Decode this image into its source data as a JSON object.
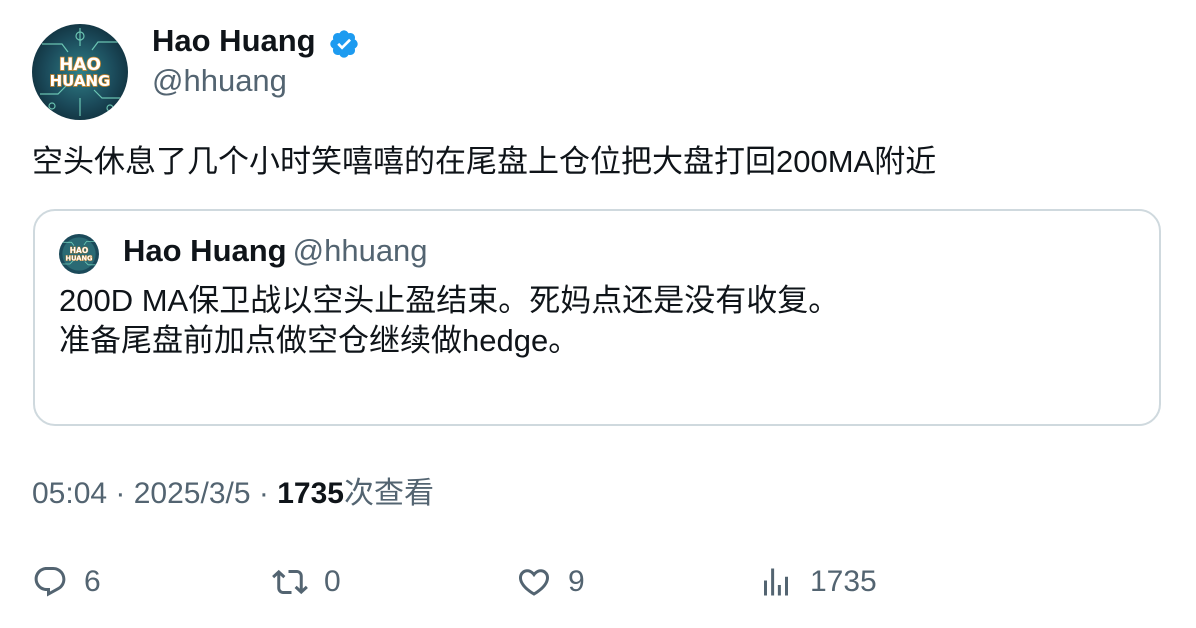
{
  "author": {
    "name": "Hao Huang",
    "handle": "@hhuang",
    "verified": true,
    "avatar_text_line1": "HAO",
    "avatar_text_line2": "HUANG"
  },
  "tweet": {
    "text": "空头休息了几个小时笑嘻嘻的在尾盘上仓位把大盘打回200MA附近"
  },
  "quote": {
    "name": "Hao Huang",
    "handle": "@hhuang",
    "line1": "200D MA保卫战以空头止盈结束。死妈点还是没有收复。",
    "line2": "准备尾盘前加点做空仓继续做hedge。"
  },
  "meta": {
    "time": "05:04",
    "sep1": " · ",
    "date": "2025/3/5",
    "sep2": " · ",
    "views_count": "1735",
    "views_label": "次查看"
  },
  "actions": {
    "reply_count": "6",
    "retweet_count": "0",
    "like_count": "9",
    "views_count": "1735"
  },
  "colors": {
    "text": "#0f1419",
    "secondary": "#536471",
    "border": "#cfd9de",
    "verified": "#1d9bf0"
  },
  "icons": [
    "verified-badge-icon",
    "reply-icon",
    "retweet-icon",
    "like-icon",
    "views-icon"
  ]
}
